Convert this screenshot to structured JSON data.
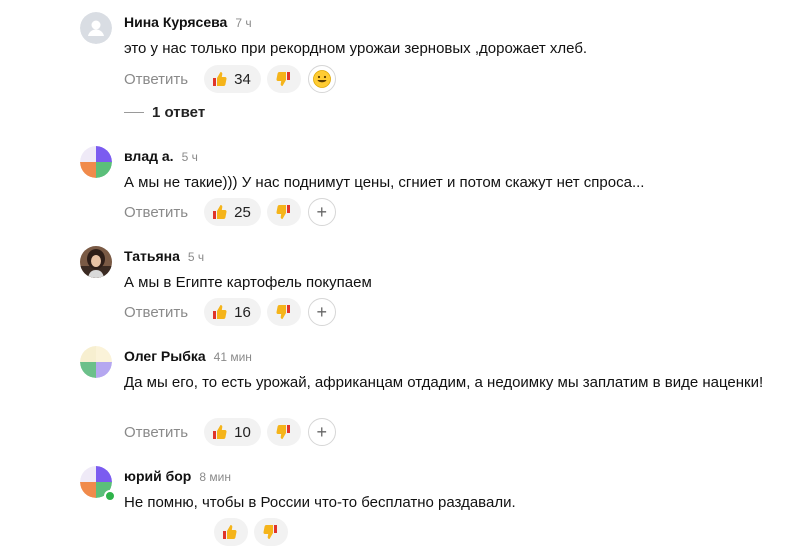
{
  "comments": [
    {
      "author": "Нина Курясева",
      "time": "7 ч",
      "text": "это у нас только при рекордном урожаи зерновых ,дорожает хлеб.",
      "reply_label": "Ответить",
      "likes": "34",
      "avatar": "default-user",
      "extra_button": "emoji",
      "replies_label": "1 ответ"
    },
    {
      "author": "влад а.",
      "time": "5 ч",
      "text": "А мы не такие))) У нас поднимут цены, сгниет и потом скажут нет спроса...",
      "reply_label": "Ответить",
      "likes": "25",
      "avatar": "quad-purple-green-orange",
      "extra_button": "plus",
      "extra_symbol": "+"
    },
    {
      "author": "Татьяна",
      "time": "5 ч",
      "text": "А мы в Египте картофель покупаем",
      "reply_label": "Ответить",
      "likes": "16",
      "avatar": "photo",
      "extra_button": "plus",
      "extra_symbol": "+"
    },
    {
      "author": "Олег Рыбка",
      "time": "41 мин",
      "text": "Да мы его, то есть урожай, африканцам отдадим, а недоимку мы заплатим в виде наценки!",
      "reply_label": "Ответить",
      "likes": "10",
      "avatar": "quad-cream-green-purple",
      "extra_button": "plus",
      "extra_symbol": "+"
    },
    {
      "author": "юрий бор",
      "time": "8 мин",
      "text": "Не помню, чтобы в России что-то бесплатно раздавали.",
      "avatar": "quad-purple-green-orange",
      "online": true
    }
  ],
  "icons": {
    "like": "thumbs-up-icon",
    "dislike": "thumbs-down-icon",
    "emoji": "smiley-icon",
    "plus": "plus-icon"
  },
  "colors": {
    "muted_text": "#8a8a8a",
    "button_bg": "#f2f2f2",
    "online": "#2fb34a",
    "thumb_yellow": "#f5b41a",
    "thumb_red": "#e0352b"
  }
}
